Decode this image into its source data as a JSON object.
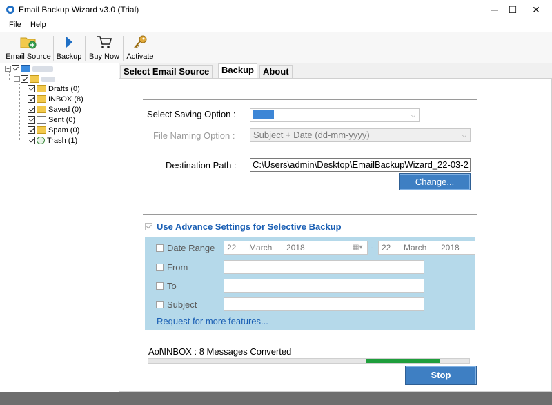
{
  "window": {
    "title": "Email Backup Wizard v3.0 (Trial)",
    "minimize_glyph": "─",
    "maximize_glyph": "☐",
    "close_glyph": "✕"
  },
  "menu": {
    "file": "File",
    "help": "Help"
  },
  "toolbar": {
    "email_source": "Email Source",
    "backup": "Backup",
    "buy_now": "Buy Now",
    "activate": "Activate"
  },
  "tree": {
    "expander_minus": "−",
    "folders": [
      {
        "label": "Drafts (0)",
        "icon": "drafts-folder-icon"
      },
      {
        "label": "INBOX (8)",
        "icon": "inbox-folder-icon"
      },
      {
        "label": "Saved (0)",
        "icon": "saved-folder-icon"
      },
      {
        "label": "Sent (0)",
        "icon": "sent-folder-icon"
      },
      {
        "label": "Spam (0)",
        "icon": "spam-folder-icon"
      },
      {
        "label": "Trash (1)",
        "icon": "trash-folder-icon"
      }
    ]
  },
  "tabs": {
    "select_email_source": "Select Email Source",
    "backup": "Backup",
    "about": "About"
  },
  "backup": {
    "saving_option_label": "Select Saving Option  :",
    "file_naming_label": "File Naming Option  :",
    "file_naming_value": "Subject + Date (dd-mm-yyyy)",
    "destination_label": "Destination Path  :",
    "destination_value": "C:\\Users\\admin\\Desktop\\EmailBackupWizard_22-03-2",
    "change_button": "Change...",
    "advance_label": "Use Advance Settings for Selective Backup",
    "date_range_label": "Date Range",
    "date_from": {
      "day": "22",
      "month": "March",
      "year": "2018"
    },
    "date_separator": "-",
    "date_to": {
      "day": "22",
      "month": "March",
      "year": "2018"
    },
    "from_label": "From",
    "to_label": "To",
    "subject_label": "Subject",
    "request_link": "Request for more features...",
    "status_text": "Aol\\INBOX : 8 Messages Converted",
    "stop_button": "Stop",
    "progress_start_fraction": 0.68,
    "progress_end_fraction": 0.91
  },
  "colors": {
    "accent_blue": "#5b97d3",
    "panel_blue": "#b5d9ea",
    "progress_green": "#1f9e3c",
    "link_blue": "#1a5fb4"
  }
}
